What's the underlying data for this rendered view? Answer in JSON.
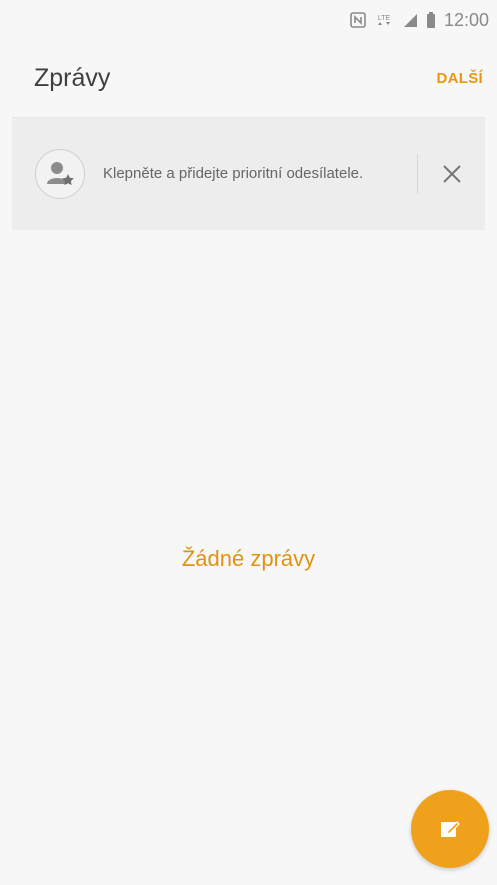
{
  "status_bar": {
    "time": "12:00",
    "icons": [
      "nfc-icon",
      "lte-icon",
      "signal-icon",
      "battery-icon"
    ],
    "lte_label": "LTE"
  },
  "header": {
    "title": "Zprávy",
    "more_label": "DALŠÍ"
  },
  "banner": {
    "text": "Klepněte a přidejte prioritní odesílatele.",
    "icon": "add-priority-contact-icon",
    "close_icon": "close-icon"
  },
  "empty_state": {
    "text": "Žádné zprávy"
  },
  "fab": {
    "icon": "compose-icon"
  },
  "colors": {
    "accent": "#e8970f",
    "fab": "#f0a11c",
    "background": "#f7f7f7",
    "banner_bg": "#ededed"
  }
}
